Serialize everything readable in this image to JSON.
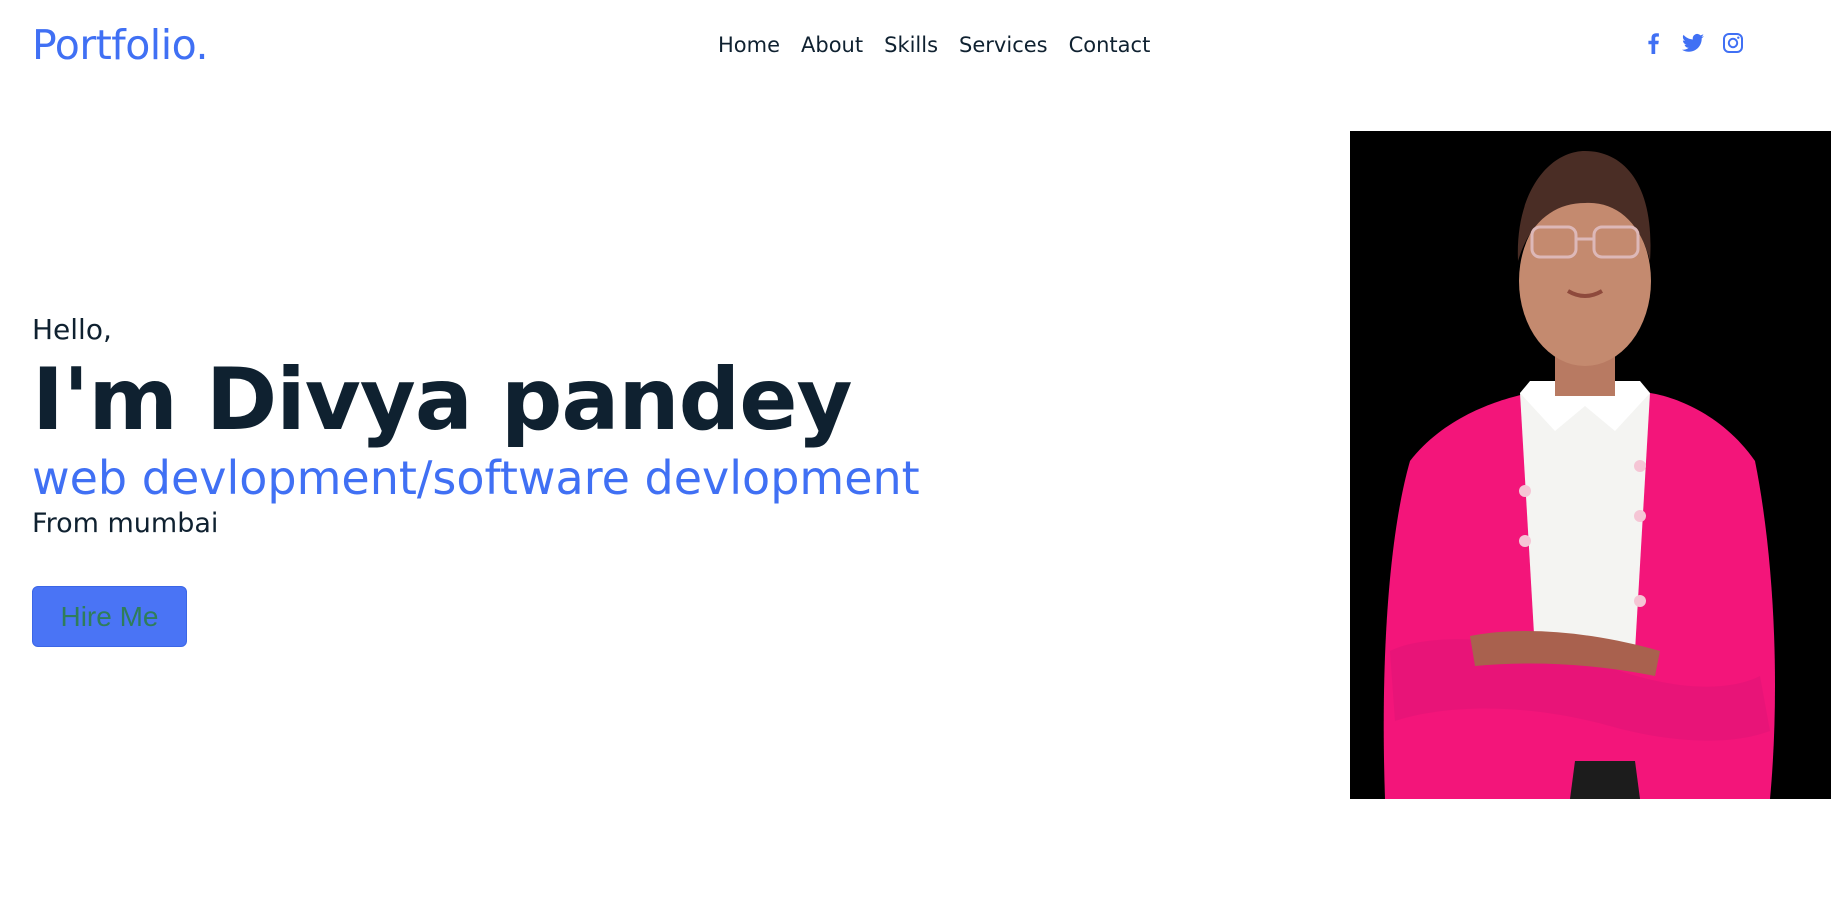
{
  "header": {
    "logo": "Portfolio.",
    "nav": [
      "Home",
      "About",
      "Skills",
      "Services",
      "Contact"
    ],
    "social_icons": [
      "facebook-icon",
      "twitter-icon",
      "instagram-icon"
    ]
  },
  "hero": {
    "greeting": "Hello,",
    "name": "I'm Divya pandey",
    "role": "web devlopment/software devlopment",
    "location": "From mumbai",
    "hire_button": "Hire Me"
  },
  "colors": {
    "accent": "#4070f4",
    "text": "#0f2130",
    "button_bg": "#4a74f5",
    "button_text": "#2f7d5a"
  }
}
